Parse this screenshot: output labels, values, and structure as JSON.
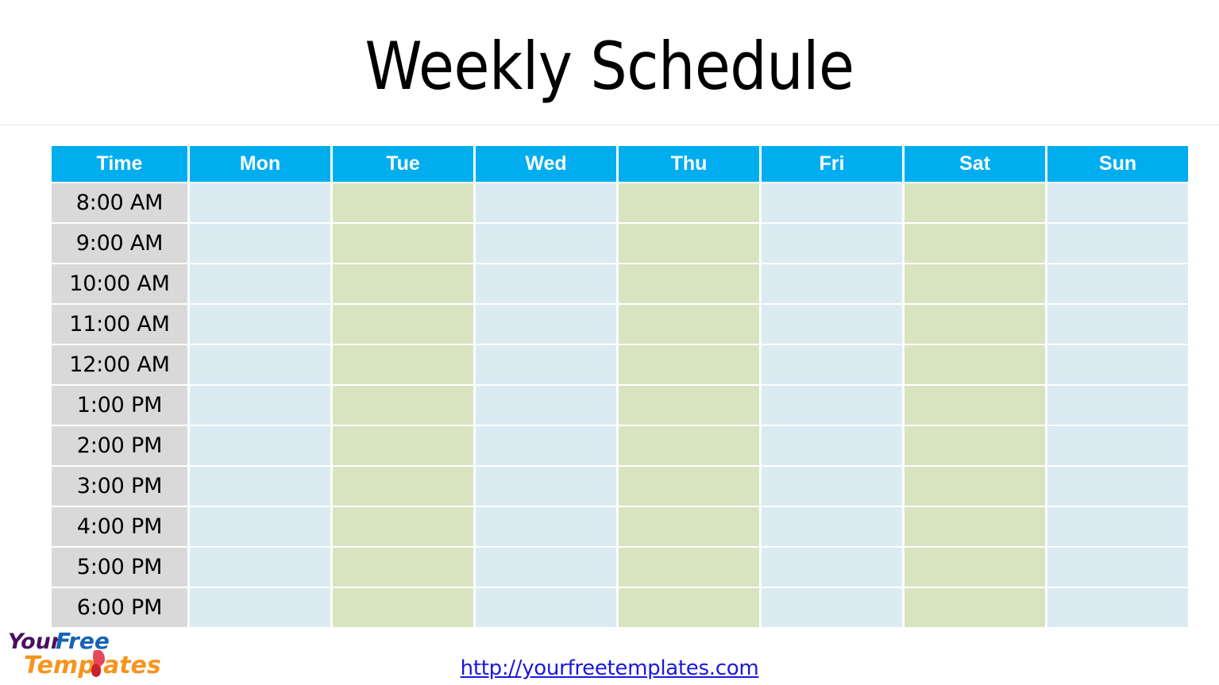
{
  "page": {
    "title": "Weekly Schedule"
  },
  "schedule": {
    "columns": [
      {
        "key": "time",
        "label": "Time",
        "type": "time"
      },
      {
        "key": "mon",
        "label": "Mon",
        "tone": "blue"
      },
      {
        "key": "tue",
        "label": "Tue",
        "tone": "green"
      },
      {
        "key": "wed",
        "label": "Wed",
        "tone": "blue"
      },
      {
        "key": "thu",
        "label": "Thu",
        "tone": "green"
      },
      {
        "key": "fri",
        "label": "Fri",
        "tone": "blue"
      },
      {
        "key": "sat",
        "label": "Sat",
        "tone": "green"
      },
      {
        "key": "sun",
        "label": "Sun",
        "tone": "blue"
      }
    ],
    "rows": [
      {
        "time": "8:00 AM",
        "cells": [
          "",
          "",
          "",
          "",
          "",
          "",
          ""
        ]
      },
      {
        "time": "9:00 AM",
        "cells": [
          "",
          "",
          "",
          "",
          "",
          "",
          ""
        ]
      },
      {
        "time": "10:00 AM",
        "cells": [
          "",
          "",
          "",
          "",
          "",
          "",
          ""
        ]
      },
      {
        "time": "11:00 AM",
        "cells": [
          "",
          "",
          "",
          "",
          "",
          "",
          ""
        ]
      },
      {
        "time": "12:00 AM",
        "cells": [
          "",
          "",
          "",
          "",
          "",
          "",
          ""
        ]
      },
      {
        "time": "1:00 PM",
        "cells": [
          "",
          "",
          "",
          "",
          "",
          "",
          ""
        ]
      },
      {
        "time": "2:00 PM",
        "cells": [
          "",
          "",
          "",
          "",
          "",
          "",
          ""
        ]
      },
      {
        "time": "3:00 PM",
        "cells": [
          "",
          "",
          "",
          "",
          "",
          "",
          ""
        ]
      },
      {
        "time": "4:00 PM",
        "cells": [
          "",
          "",
          "",
          "",
          "",
          "",
          ""
        ]
      },
      {
        "time": "5:00 PM",
        "cells": [
          "",
          "",
          "",
          "",
          "",
          "",
          ""
        ]
      },
      {
        "time": "6:00 PM",
        "cells": [
          "",
          "",
          "",
          "",
          "",
          "",
          ""
        ]
      }
    ]
  },
  "footer": {
    "url_text": "http://yourfreetemplates.com"
  },
  "logo": {
    "word1": "Your",
    "word2": "Free",
    "word3": "Templates"
  },
  "colors": {
    "header_cyan": "#00ADEE",
    "time_gray": "#D9D9D9",
    "slot_blue": "#DCEAF2",
    "slot_green": "#D8E4C0",
    "link_blue": "#1A18E0",
    "logo_purple": "#4B1060",
    "logo_blue": "#1763B6",
    "logo_orange": "#F7941E",
    "logo_red": "#E8465A"
  }
}
